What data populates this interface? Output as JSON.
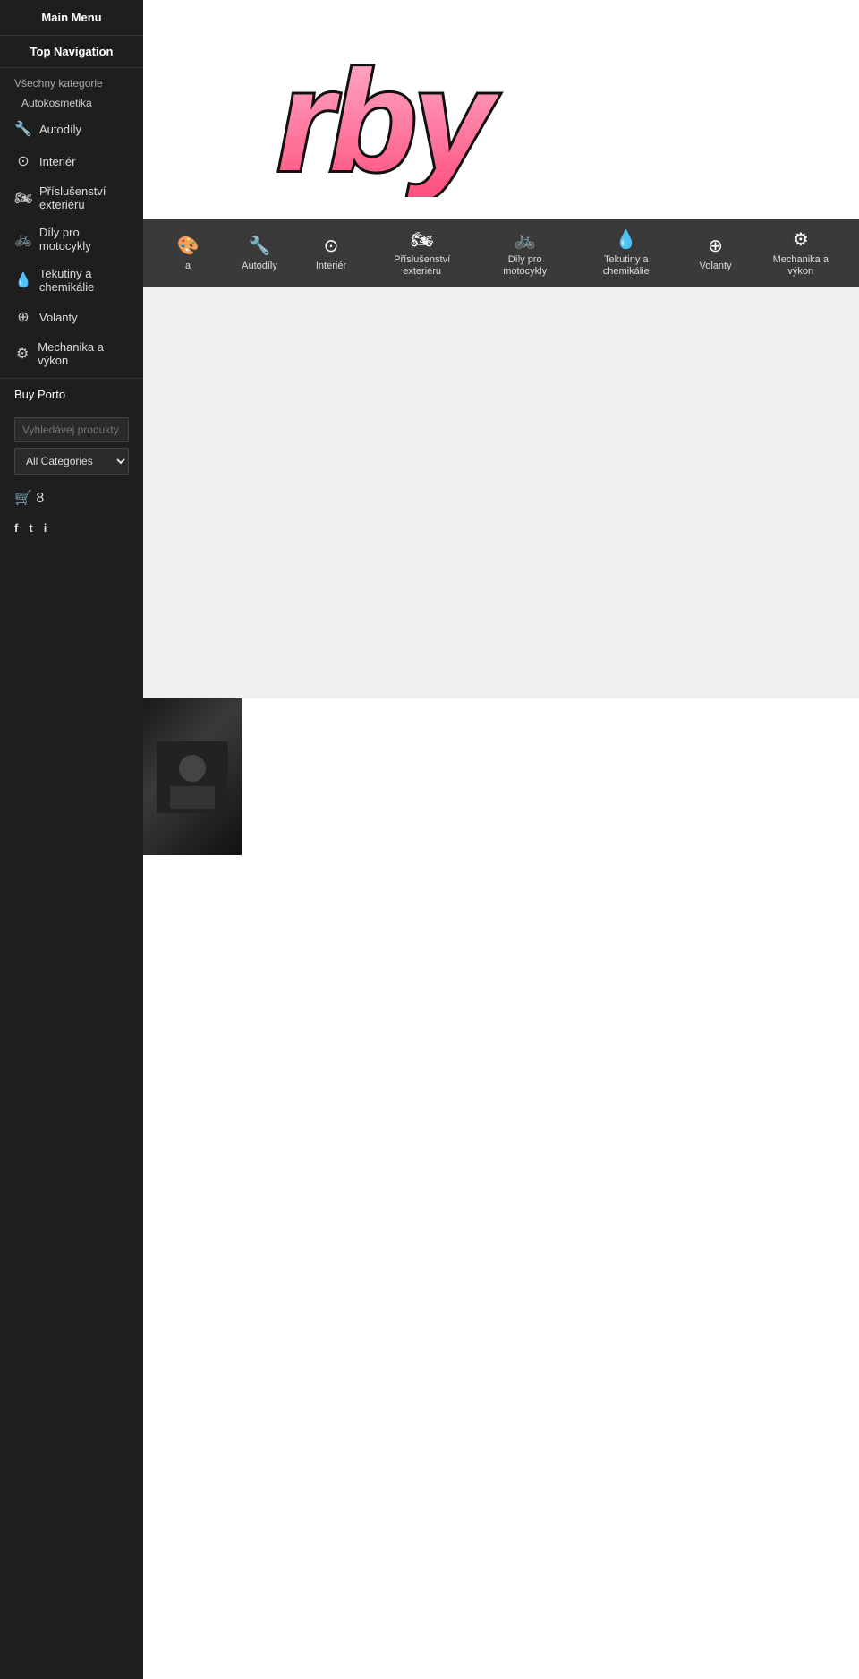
{
  "sidebar": {
    "main_menu_label": "Main Menu",
    "top_navigation_label": "Top Navigation",
    "section_label": "Všechny kategorie",
    "subsection_autokosmetika": "Autokosmetika",
    "items": [
      {
        "id": "autodily",
        "label": "Autodíly",
        "icon": "🔧"
      },
      {
        "id": "interiér",
        "label": "Interiér",
        "icon": "⊙"
      },
      {
        "id": "prislusenstvi-exterieru",
        "label": "Příslušenství exteriéru",
        "icon": "🏍"
      },
      {
        "id": "dily-pro-motocykly",
        "label": "Díly pro motocykly",
        "icon": "🚲"
      },
      {
        "id": "tekutiny-a-chemikalie",
        "label": "Tekutiny a chemikálie",
        "icon": "💧"
      },
      {
        "id": "volanty",
        "label": "Volanty",
        "icon": "⊕"
      },
      {
        "id": "mechanika-a-vykon",
        "label": "Mechanika a výkon",
        "icon": "⚙"
      }
    ],
    "buy_porto_label": "Buy Porto",
    "search_placeholder": "Vyhledávej produkty",
    "categories_default": "All Categories",
    "cart_count": "8",
    "social": [
      {
        "id": "facebook",
        "icon": "f"
      },
      {
        "id": "twitter",
        "icon": "t"
      },
      {
        "id": "instagram",
        "icon": "i"
      }
    ]
  },
  "header": {
    "logo_text": "rby"
  },
  "top_nav": {
    "items": [
      {
        "id": "autokosmetika",
        "label": "a",
        "icon": "🎨"
      },
      {
        "id": "autodily",
        "label": "Autodíly",
        "icon": "🔧"
      },
      {
        "id": "interiér",
        "label": "Interiér",
        "icon": "⊙"
      },
      {
        "id": "prislusenstvi-exterieru",
        "label": "Příslušenství exteriéru",
        "icon": "🏍"
      },
      {
        "id": "dily-pro-motocykly",
        "label": "Díly pro motocykly",
        "icon": "🚲"
      },
      {
        "id": "tekutiny-a-chemikalie",
        "label": "Tekutiny a chemikálie",
        "icon": "💧"
      },
      {
        "id": "volanty",
        "label": "Volanty",
        "icon": "⊕"
      },
      {
        "id": "mechanika-a-vykon",
        "label": "Mechanika a výkon",
        "icon": "⚙"
      }
    ]
  },
  "colors": {
    "sidebar_bg": "#1e1e1e",
    "nav_bar_bg": "#3a3a3a",
    "content_bg": "#f0f0f0",
    "logo_gradient_start": "#ffb3cc",
    "logo_gradient_end": "#ff4d7d",
    "accent": "#ff6b9d"
  }
}
